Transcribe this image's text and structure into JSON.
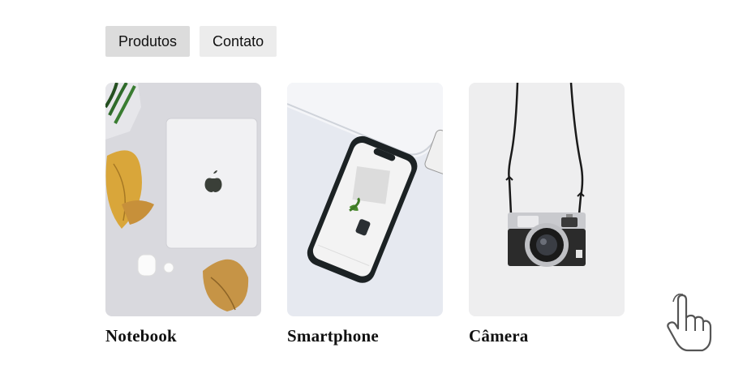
{
  "nav": {
    "items": [
      {
        "label": "Produtos",
        "active": true
      },
      {
        "label": "Contato",
        "active": false
      }
    ]
  },
  "products": [
    {
      "title": "Notebook",
      "image": "laptop-photo"
    },
    {
      "title": "Smartphone",
      "image": "smartphone-photo"
    },
    {
      "title": "Câmera",
      "image": "camera-photo"
    }
  ],
  "cursor": {
    "icon": "hand-pointer-icon"
  }
}
